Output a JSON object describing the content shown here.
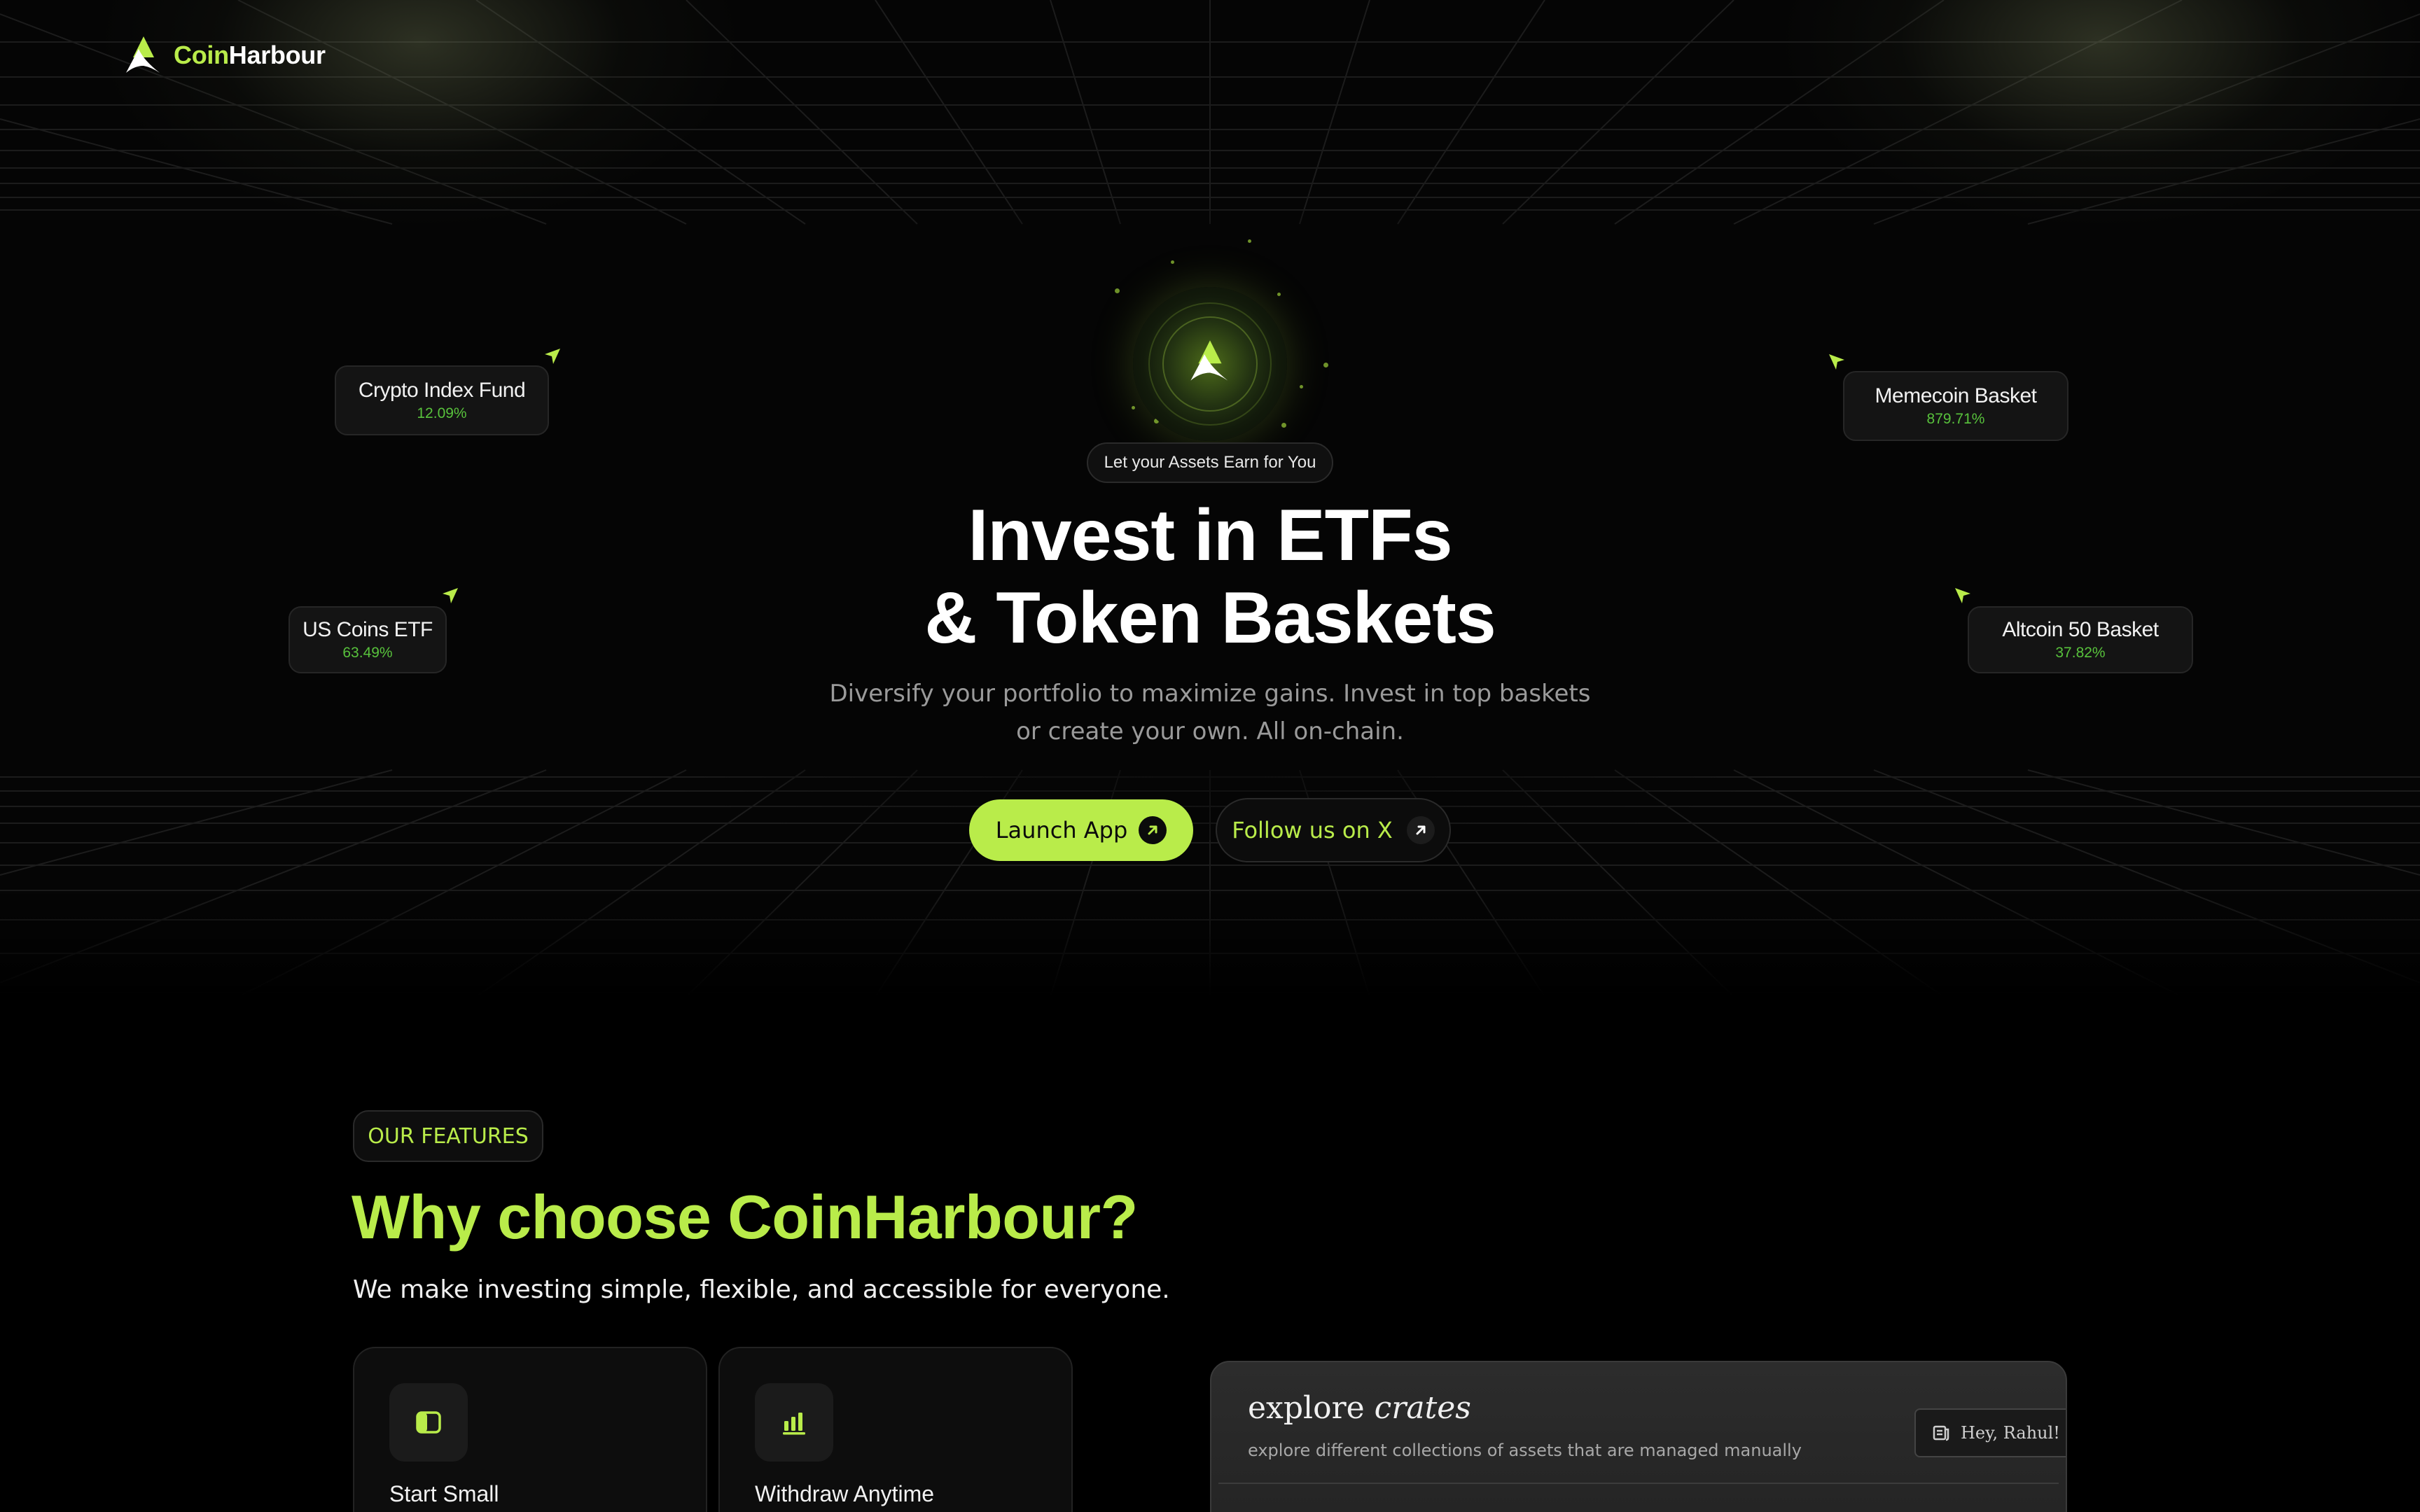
{
  "brand": {
    "name_accent": "Coin",
    "name_rest": "Harbour"
  },
  "hero": {
    "tagline": "Let your Assets Earn for You",
    "title_line1": "Invest in ETFs",
    "title_line2": "& Token Baskets",
    "subtitle_line1": "Diversify your portfolio to maximize gains. Invest in top baskets",
    "subtitle_line2": "or create your own. All on-chain.",
    "launch_label": "Launch App",
    "follow_label": "Follow us on X"
  },
  "floating_cards": [
    {
      "name": "Crypto Index Fund",
      "value": "12.09%"
    },
    {
      "name": "US Coins ETF",
      "value": "63.49%"
    },
    {
      "name": "Memecoin Basket",
      "value": "879.71%"
    },
    {
      "name": "Altcoin 50 Basket",
      "value": "37.82%"
    }
  ],
  "features": {
    "pill": "OUR FEATURES",
    "title": "Why choose CoinHarbour?",
    "subtitle": "We make investing simple, flexible, and accessible for everyone.",
    "cards": [
      {
        "label": "Start Small",
        "icon": "wallet-icon"
      },
      {
        "label": "Withdraw Anytime",
        "icon": "bar-chart-icon"
      }
    ]
  },
  "preview": {
    "title_plain": "explore",
    "title_italic": "crates",
    "subtitle": "explore different collections of assets that are managed manually",
    "greeting": "Hey, Rahul! I"
  },
  "colors": {
    "accent": "#b9ec4a",
    "positive": "#58c23c",
    "background": "#000000"
  }
}
